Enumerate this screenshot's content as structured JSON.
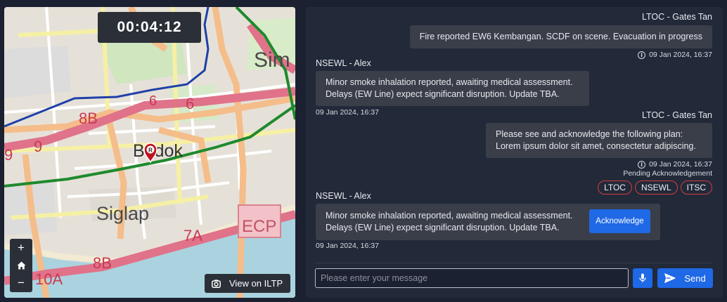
{
  "map": {
    "timer": "00:04:12",
    "labels": {
      "sim": "Sim",
      "bedok": "Bedok",
      "siglap": "Siglap",
      "ecp": "ECP",
      "road_8b_top": "8B",
      "road_9a": "9",
      "road_9b": "9",
      "road_6a": "6",
      "road_6b": "6",
      "road_7a": "7A",
      "road_8b_bottom": "8B",
      "road_10a": "10A",
      "marker": "R"
    },
    "zoom_in_label": "+",
    "zoom_out_label": "−",
    "view_button_label": "View on ILTP",
    "colors": {
      "water": "#aad3df",
      "green_line": "#1e8a2d",
      "blue_line": "#1e40a8",
      "expressway": "#e0728a"
    }
  },
  "chat": {
    "messages": [
      {
        "sender": "LTOC - Gates Tan",
        "lines": [
          "Fire reported EW6 Kembangan. SCDF on scene. Evacuation in progress"
        ],
        "timestamp": "09 Jan 2024, 16:37"
      },
      {
        "sender": "NSEWL - Alex",
        "lines": [
          "Minor smoke inhalation reported, awaiting medical assessment.",
          "Delays (EW Line) expect significant disruption. Update TBA."
        ],
        "timestamp": "09 Jan 2024, 16:37"
      },
      {
        "sender": "LTOC - Gates Tan",
        "lines": [
          "Please see and acknowledge the following plan:",
          "Lorem ipsum dolor sit amet, consectetur adipiscing."
        ],
        "timestamp": "09 Jan 2024, 16:37"
      },
      {
        "sender": "NSEWL - Alex",
        "lines": [
          "Minor smoke inhalation reported, awaiting medical assessment.",
          "Delays (EW Line) expect significant disruption. Update TBA."
        ],
        "timestamp": "09 Jan 2024, 16:37"
      }
    ],
    "pending_label": "Pending Acknowledgement",
    "pending_tags": [
      "LTOC",
      "NSEWL",
      "ITSC"
    ],
    "acknowledge_label": "Acknowledge",
    "input_placeholder": "Please enter your message",
    "send_label": "Send",
    "accent_color": "#1f68e6",
    "pending_color": "#d13f3f"
  }
}
